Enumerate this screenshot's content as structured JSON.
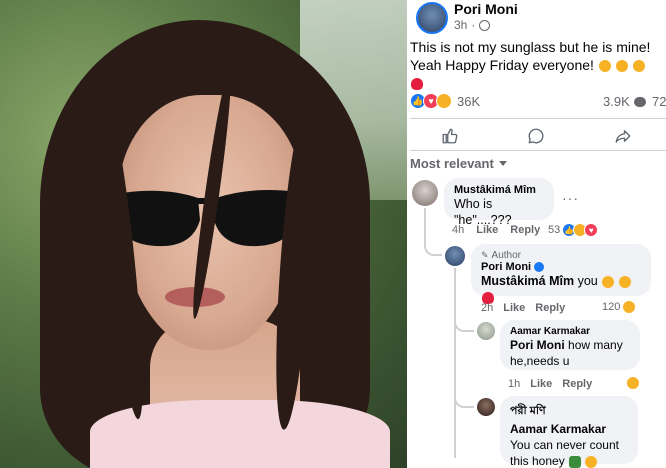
{
  "post": {
    "author": "Pori Moni",
    "time": "3h",
    "separator": "·",
    "text": "This is not my sunglass but he is mine! Yeah Happy Friday everyone!",
    "reaction_count": "36K",
    "comment_count": "3.9K",
    "share_count": "72"
  },
  "actions": {
    "like_icon": "thumbs-up-icon",
    "comment_icon": "comment-icon",
    "share_icon": "share-icon"
  },
  "sort": {
    "label": "Most relevant"
  },
  "comments": [
    {
      "name": "Mustâkimá Mîm",
      "text": "Who is \"he\"....???",
      "time": "4h",
      "like": "Like",
      "reply": "Reply",
      "reactions": "53"
    },
    {
      "tag": "Author",
      "name": "Pori Moni",
      "mention": "Mustâkimá Mîm",
      "text": "you",
      "time": "2h",
      "like": "Like",
      "reply": "Reply",
      "reactions": "120"
    },
    {
      "name": "Aamar Karmakar",
      "mention": "Pori Moni",
      "text": "how many he,needs u",
      "time": "1h",
      "like": "Like",
      "reply": "Reply"
    },
    {
      "name": "পরী মণি",
      "mention": "Aamar Karmakar",
      "text": "You can never count this honey"
    }
  ],
  "colors": {
    "brand": "#1877f2",
    "bubble": "#f0f2f5",
    "muted": "#65676b"
  }
}
